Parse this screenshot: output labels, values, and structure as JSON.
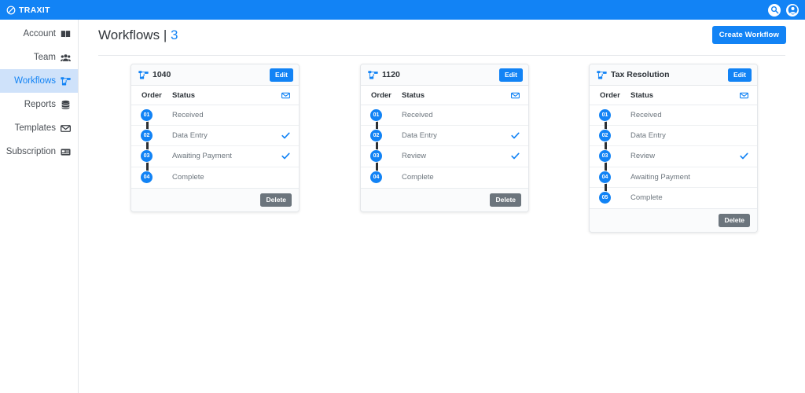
{
  "topbar": {
    "brand_name": "TRAXIT",
    "brand_icon": "ban-circle-slash-icon",
    "search_icon": "search-icon",
    "account_icon": "user-circle-icon",
    "background_color": "#1283f5"
  },
  "sidebar": {
    "items": [
      {
        "label": "Account",
        "icon": "book-icon",
        "active": false
      },
      {
        "label": "Team",
        "icon": "users-group-icon",
        "active": false
      },
      {
        "label": "Workflows",
        "icon": "project-diagram-icon",
        "active": true
      },
      {
        "label": "Reports",
        "icon": "database-stack-icon",
        "active": false
      },
      {
        "label": "Templates",
        "icon": "envelope-icon",
        "active": false
      },
      {
        "label": "Subscription",
        "icon": "credit-card-icon",
        "active": false
      }
    ],
    "active_background": "#cfe2fa",
    "active_text_color": "#1283f5"
  },
  "header": {
    "title": "Workflows",
    "separator": "|",
    "count": "3",
    "create_button_label": "Create Workflow",
    "accent_color": "#1283f5"
  },
  "table": {
    "order_header": "Order",
    "status_header": "Status",
    "mail_icon": "envelope-icon"
  },
  "buttons": {
    "edit_label": "Edit",
    "delete_label": "Delete",
    "edit_color": "#1283f5",
    "delete_color": "#6c757d"
  },
  "cards": [
    {
      "title": "1040",
      "icon": "project-diagram-icon",
      "rows": [
        {
          "order": "01",
          "status": "Received",
          "checked": false
        },
        {
          "order": "02",
          "status": "Data Entry",
          "checked": true
        },
        {
          "order": "03",
          "status": "Awaiting Payment",
          "checked": true
        },
        {
          "order": "04",
          "status": "Complete",
          "checked": false
        }
      ]
    },
    {
      "title": "1120",
      "icon": "project-diagram-icon",
      "rows": [
        {
          "order": "01",
          "status": "Received",
          "checked": false
        },
        {
          "order": "02",
          "status": "Data Entry",
          "checked": true
        },
        {
          "order": "03",
          "status": "Review",
          "checked": true
        },
        {
          "order": "04",
          "status": "Complete",
          "checked": false
        }
      ]
    },
    {
      "title": "Tax Resolution",
      "icon": "project-diagram-icon",
      "rows": [
        {
          "order": "01",
          "status": "Received",
          "checked": false
        },
        {
          "order": "02",
          "status": "Data Entry",
          "checked": false
        },
        {
          "order": "03",
          "status": "Review",
          "checked": true
        },
        {
          "order": "04",
          "status": "Awaiting Payment",
          "checked": false
        },
        {
          "order": "05",
          "status": "Complete",
          "checked": false
        }
      ]
    }
  ]
}
